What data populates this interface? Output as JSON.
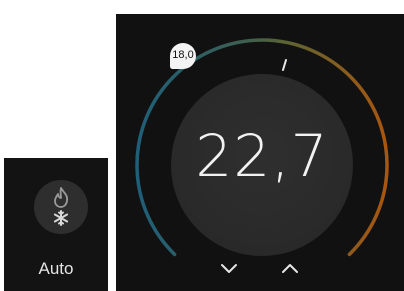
{
  "mode": {
    "label": "Auto",
    "icons": [
      "flame-icon",
      "snowflake-icon"
    ]
  },
  "thermostat": {
    "current_temperature": "22,7",
    "setpoint": "18,0",
    "controls": {
      "decrease_icon": "chevron-down-icon",
      "increase_icon": "chevron-up-icon"
    }
  },
  "colors": {
    "background": "#111111",
    "cold": "#1e5f79",
    "mid": "#5d6b33",
    "hot": "#a9560f",
    "text": "#f2f2f2"
  }
}
